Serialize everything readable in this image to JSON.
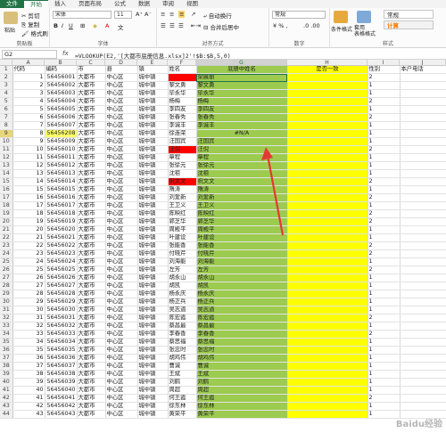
{
  "tabs": [
    "文件",
    "开始",
    "插入",
    "页面布局",
    "公式",
    "数据",
    "审阅",
    "视图"
  ],
  "active_tab_index": 1,
  "ribbon": {
    "clipboard": {
      "label": "剪贴板",
      "paste": "粘贴",
      "cut": "剪切",
      "copy": "复制",
      "format_painter": "格式刷"
    },
    "font": {
      "label": "字体",
      "font_name": "宋体",
      "font_size": "11"
    },
    "alignment": {
      "label": "对齐方式",
      "wrap": "自动换行",
      "merge": "合并后居中"
    },
    "number": {
      "label": "数字",
      "format": "常规"
    },
    "styles": {
      "label": "样式",
      "conditional": "条件格式",
      "table": "套用\n表格格式",
      "normal": "常规",
      "calc": "计算",
      "bad": "差",
      "check": "检查单元格"
    }
  },
  "formula_bar": {
    "name_box": "G2",
    "fx": "fx",
    "formula": "=VLOOKUP(E2,'[大都市底册信息.xlsx]2'!$B:$B,5,0)"
  },
  "columns": [
    "A",
    "B",
    "C",
    "D",
    "E",
    "F",
    "G",
    "H",
    "I",
    "J"
  ],
  "selected_column": "G",
  "header_row": [
    "代码",
    "编码",
    "市",
    "县",
    "镇",
    "姓名",
    "底册中姓名",
    "是否一致",
    "性别",
    "本户电话"
  ],
  "error_value": "#N/A",
  "rows": [
    {
      "a": "1",
      "b": "56456001",
      "c": "大都市",
      "d": "中心区",
      "e": "城中镇",
      "f": "",
      "g": "梁晨丽",
      "i": "2"
    },
    {
      "a": "2",
      "b": "56456002",
      "c": "大都市",
      "d": "中心区",
      "e": "城中镇",
      "f": "黎文勇",
      "g": "黎文勇",
      "i": "1"
    },
    {
      "a": "3",
      "b": "56456003",
      "c": "大都市",
      "d": "中心区",
      "e": "城中镇",
      "f": "毕永华",
      "g": "毕永华",
      "i": "1"
    },
    {
      "a": "4",
      "b": "56456004",
      "c": "大都市",
      "d": "中心区",
      "e": "城中镇",
      "f": "杨梅",
      "g": "杨梅",
      "i": "2"
    },
    {
      "a": "5",
      "b": "56456005",
      "c": "大都市",
      "d": "中心区",
      "e": "城中镇",
      "f": "李四友",
      "g": "李四友",
      "i": "1"
    },
    {
      "a": "6",
      "b": "56456006",
      "c": "大都市",
      "d": "中心区",
      "e": "城中镇",
      "f": "张春秀",
      "g": "张春秀",
      "i": "2"
    },
    {
      "a": "7",
      "b": "56456007",
      "c": "大都市",
      "d": "中心区",
      "e": "城中镇",
      "f": "李诚丰",
      "g": "李诚丰",
      "i": "1"
    },
    {
      "a": "8",
      "b": "56456208",
      "c": "大都市",
      "d": "中心区",
      "e": "城中镇",
      "f": "徐连荣",
      "g": "#N/A",
      "i": "1"
    },
    {
      "a": "9",
      "b": "56456009",
      "c": "大都市",
      "d": "中心区",
      "e": "城中镇",
      "f": "汪国宾",
      "g": "汪国宾",
      "i": "1"
    },
    {
      "a": "10",
      "b": "56456010",
      "c": "大都市",
      "d": "中心区",
      "e": "城中镇",
      "f": "汪倪",
      "g": "汪倪",
      "i": "2"
    },
    {
      "a": "11",
      "b": "56456011",
      "c": "大都市",
      "d": "中心区",
      "e": "城中镇",
      "f": "章程",
      "g": "章程",
      "i": "1"
    },
    {
      "a": "12",
      "b": "56456012",
      "c": "大都市",
      "d": "中心区",
      "e": "城中镇",
      "f": "张徐元",
      "g": "张徐元",
      "i": "1"
    },
    {
      "a": "13",
      "b": "56456013",
      "c": "大都市",
      "d": "中心区",
      "e": "城中镇",
      "f": "沈祖",
      "g": "沈祖",
      "i": "1"
    },
    {
      "a": "14",
      "b": "56456014",
      "c": "大都市",
      "d": "中心区",
      "e": "城中镇",
      "f": "祝文文",
      "g": "祝文文",
      "i": "2"
    },
    {
      "a": "15",
      "b": "56456015",
      "c": "大都市",
      "d": "中心区",
      "e": "城中镇",
      "f": "隋涛",
      "g": "隋涛",
      "i": "1"
    },
    {
      "a": "16",
      "b": "56456016",
      "c": "大都市",
      "d": "中心区",
      "e": "城中镇",
      "f": "刘爱新",
      "g": "刘爱新",
      "i": "2"
    },
    {
      "a": "17",
      "b": "56456017",
      "c": "大都市",
      "d": "中心区",
      "e": "城中镇",
      "f": "王卫义",
      "g": "王卫义",
      "i": "1"
    },
    {
      "a": "18",
      "b": "56456018",
      "c": "大都市",
      "d": "中心区",
      "e": "城中镇",
      "f": "陈映红",
      "g": "陈映红",
      "i": "2"
    },
    {
      "a": "19",
      "b": "56456019",
      "c": "大都市",
      "d": "中心区",
      "e": "城中镇",
      "f": "郭芝华",
      "g": "郭芝华",
      "i": "2"
    },
    {
      "a": "20",
      "b": "56456020",
      "c": "大都市",
      "d": "中心区",
      "e": "城中镇",
      "f": "周殿平",
      "g": "周殿平",
      "i": "1"
    },
    {
      "a": "21",
      "b": "56456021",
      "c": "大都市",
      "d": "中心区",
      "e": "城中镇",
      "f": "叶建设",
      "g": "叶建设",
      "i": "1"
    },
    {
      "a": "22",
      "b": "56456022",
      "c": "大都市",
      "d": "中心区",
      "e": "城中镇",
      "f": "张能香",
      "g": "张能香",
      "i": "2"
    },
    {
      "a": "23",
      "b": "56456023",
      "c": "大都市",
      "d": "中心区",
      "e": "城中镇",
      "f": "付晓芹",
      "g": "付晓芹",
      "i": "2"
    },
    {
      "a": "24",
      "b": "56456024",
      "c": "大都市",
      "d": "中心区",
      "e": "城中镇",
      "f": "刘海能",
      "g": "刘海能",
      "i": "1"
    },
    {
      "a": "25",
      "b": "56456025",
      "c": "大都市",
      "d": "中心区",
      "e": "城中镇",
      "f": "左芳",
      "g": "左芳",
      "i": "2"
    },
    {
      "a": "26",
      "b": "56456026",
      "c": "大都市",
      "d": "中心区",
      "e": "城中镇",
      "f": "胡永山",
      "g": "胡永山",
      "i": "1"
    },
    {
      "a": "27",
      "b": "56456027",
      "c": "大都市",
      "d": "中心区",
      "e": "城中镇",
      "f": "胡凯",
      "g": "胡凯",
      "i": "1"
    },
    {
      "a": "28",
      "b": "56456028",
      "c": "大都市",
      "d": "中心区",
      "e": "城中镇",
      "f": "杨永庆",
      "g": "杨永庆",
      "i": "1"
    },
    {
      "a": "29",
      "b": "56456029",
      "c": "大都市",
      "d": "中心区",
      "e": "城中镇",
      "f": "杨正兵",
      "g": "杨正兵",
      "i": "1"
    },
    {
      "a": "30",
      "b": "56456030",
      "c": "大都市",
      "d": "中心区",
      "e": "城中镇",
      "f": "吴志道",
      "g": "吴志道",
      "i": "1"
    },
    {
      "a": "31",
      "b": "56456031",
      "c": "大都市",
      "d": "中心区",
      "e": "城中镇",
      "f": "陈宏霞",
      "g": "陈宏霞",
      "i": "2"
    },
    {
      "a": "32",
      "b": "56456032",
      "c": "大都市",
      "d": "中心区",
      "e": "城中镇",
      "f": "蔡昌最",
      "g": "蔡昌最",
      "i": "1"
    },
    {
      "a": "33",
      "b": "56456033",
      "c": "大都市",
      "d": "中心区",
      "e": "城中镇",
      "f": "李春香",
      "g": "李春香",
      "i": "2"
    },
    {
      "a": "34",
      "b": "56456034",
      "c": "大都市",
      "d": "中心区",
      "e": "城中镇",
      "f": "蔡思福",
      "g": "蔡思福",
      "i": "1"
    },
    {
      "a": "35",
      "b": "56456035",
      "c": "大都市",
      "d": "中心区",
      "e": "城中镇",
      "f": "张忠时",
      "g": "张忠时",
      "i": "1"
    },
    {
      "a": "36",
      "b": "56456036",
      "c": "大都市",
      "d": "中心区",
      "e": "城中镇",
      "f": "胡鸡伟",
      "g": "胡鸡伟",
      "i": "1"
    },
    {
      "a": "37",
      "b": "56456037",
      "c": "大都市",
      "d": "中心区",
      "e": "城中镇",
      "f": "曹诚",
      "g": "曹诚",
      "i": "1"
    },
    {
      "a": "38",
      "b": "56456038",
      "c": "大都市",
      "d": "中心区",
      "e": "城中镇",
      "f": "王斌",
      "g": "王斌",
      "i": "1"
    },
    {
      "a": "39",
      "b": "56456039",
      "c": "大都市",
      "d": "中心区",
      "e": "城中镇",
      "f": "刘鹤",
      "g": "刘鹤",
      "i": "1"
    },
    {
      "a": "40",
      "b": "56456040",
      "c": "大都市",
      "d": "中心区",
      "e": "城中镇",
      "f": "周超",
      "g": "周超",
      "i": "1"
    },
    {
      "a": "41",
      "b": "56456041",
      "c": "大都市",
      "d": "中心区",
      "e": "城中镇",
      "f": "何王霞",
      "g": "何王霞",
      "i": "2"
    },
    {
      "a": "42",
      "b": "56456042",
      "c": "大都市",
      "d": "中心区",
      "e": "城中镇",
      "f": "徐东林",
      "g": "徐东林",
      "i": "1"
    },
    {
      "a": "43",
      "b": "56456043",
      "c": "大都市",
      "d": "中心区",
      "e": "城中镇",
      "f": "黄荣平",
      "g": "黄荣平",
      "i": "1"
    }
  ],
  "watermark": "Baidu经验",
  "colors": {
    "green": "#9ccb4f",
    "yellow": "#ffff00",
    "red": "#ff0000",
    "excel_green": "#217346",
    "arrow": "#e53935"
  }
}
